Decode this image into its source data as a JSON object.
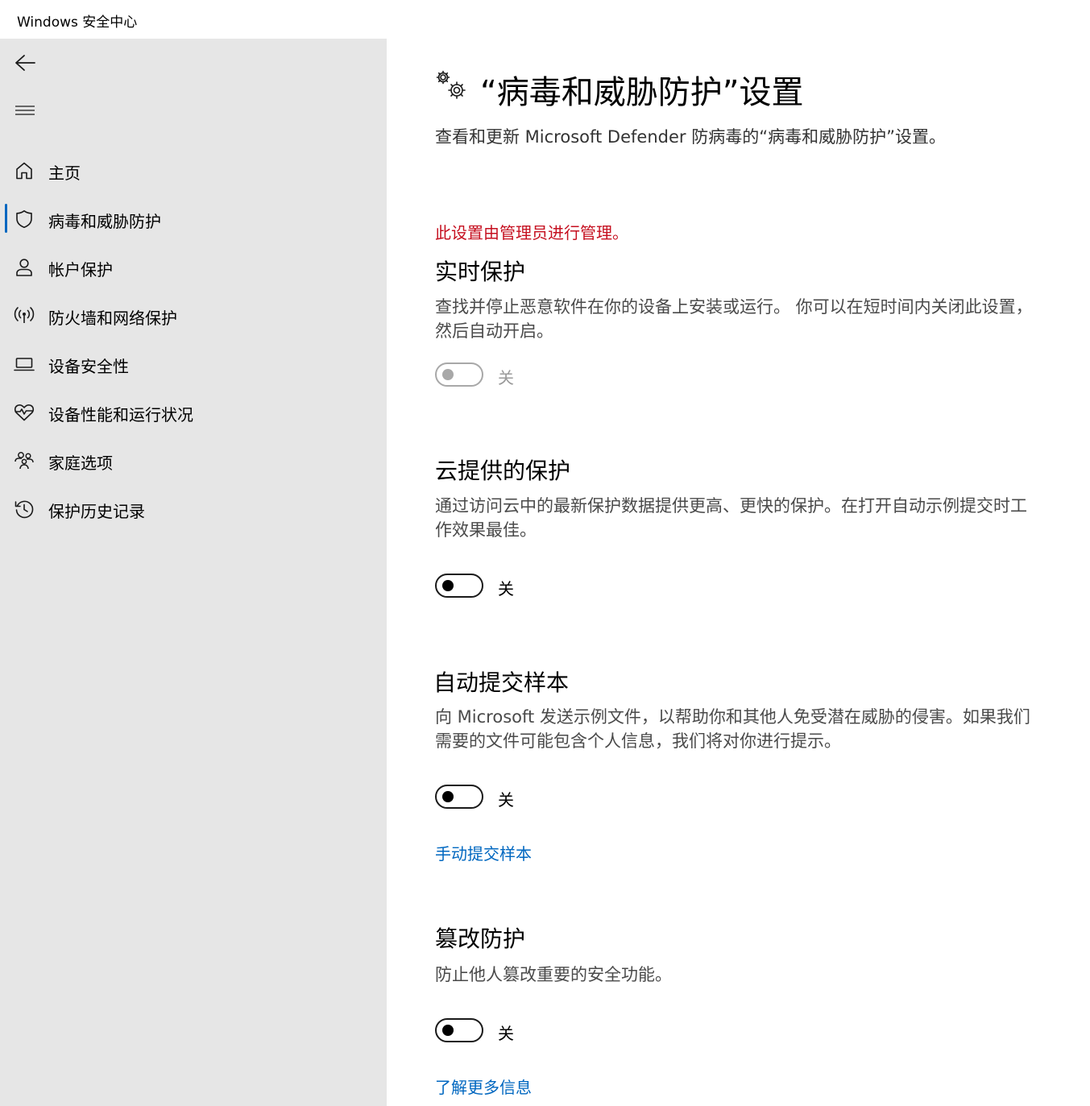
{
  "window": {
    "title": "Windows 安全中心"
  },
  "sidebar": {
    "back_icon": "back-arrow-icon",
    "menu_icon": "hamburger-menu-icon",
    "items": [
      {
        "label": "主页",
        "icon": "home-icon",
        "active": false
      },
      {
        "label": "病毒和威胁防护",
        "icon": "shield-icon",
        "active": true
      },
      {
        "label": "帐户保护",
        "icon": "person-icon",
        "active": false
      },
      {
        "label": "防火墙和网络保护",
        "icon": "antenna-icon",
        "active": false
      },
      {
        "label": "设备安全性",
        "icon": "laptop-icon",
        "active": false
      },
      {
        "label": "设备性能和运行状况",
        "icon": "heartbeat-icon",
        "active": false
      },
      {
        "label": "家庭选项",
        "icon": "family-icon",
        "active": false
      },
      {
        "label": "保护历史记录",
        "icon": "history-icon",
        "active": false
      }
    ],
    "accent_color": "#0067c0"
  },
  "main": {
    "header_icon": "gears-icon",
    "title": "“病毒和威胁防护”设置",
    "subtitle": "查看和更新 Microsoft Defender 防病毒的“病毒和威胁防护”设置。",
    "admin_note": "此设置由管理员进行管理。",
    "admin_note_color": "#c50f1f",
    "sections": [
      {
        "title": "实时保护",
        "description": "查找并停止恶意软件在你的设备上安装或运行。 你可以在短时间内关闭此设置，然后自动开启。",
        "toggle_state": "关",
        "toggle_on": false,
        "toggle_disabled": true
      },
      {
        "title": "云提供的保护",
        "description": "通过访问云中的最新保护数据提供更高、更快的保护。在打开自动示例提交时工作效果最佳。",
        "toggle_state": "关",
        "toggle_on": false,
        "toggle_disabled": false
      },
      {
        "title": "自动提交样本",
        "description": "向 Microsoft 发送示例文件，以帮助你和其他人免受潜在威胁的侵害。如果我们需要的文件可能包含个人信息，我们将对你进行提示。",
        "toggle_state": "关",
        "toggle_on": false,
        "toggle_disabled": false,
        "link": "手动提交样本"
      },
      {
        "title": "篡改防护",
        "description": "防止他人篡改重要的安全功能。",
        "toggle_state": "关",
        "toggle_on": false,
        "toggle_disabled": false,
        "link": "了解更多信息"
      }
    ],
    "link_color": "#0067c0"
  }
}
